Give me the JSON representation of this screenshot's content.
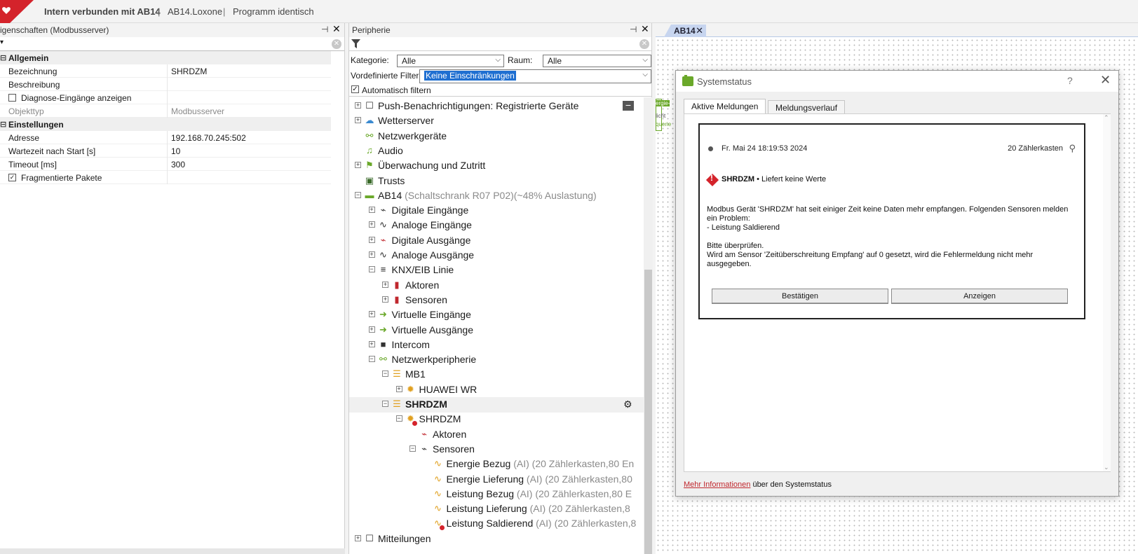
{
  "titlebar": {
    "main": "Intern verbunden mit AB14",
    "sep": "|",
    "file": "AB14.Loxone",
    "status": "Programm identisch"
  },
  "props": {
    "title": "igenschaften (Modbusserver)",
    "pin": "⊣",
    "close": "✕",
    "rows": [
      {
        "k": "Allgemein",
        "v": "",
        "cat": true
      },
      {
        "k": "Bezeichnung",
        "v": "SHRDZM"
      },
      {
        "k": "Beschreibung",
        "v": ""
      },
      {
        "k": "Diagnose-Eingänge anzeigen",
        "v": "",
        "checkbox": false
      },
      {
        "k": "Objekttyp",
        "v": "Modbusserver",
        "muted": true
      },
      {
        "k": "Einstellungen",
        "v": "",
        "cat": true
      },
      {
        "k": "Adresse",
        "v": "192.168.70.245:502"
      },
      {
        "k": "Wartezeit nach Start [s]",
        "v": "10"
      },
      {
        "k": "Timeout [ms]",
        "v": "300"
      },
      {
        "k": "Fragmentierte Pakete",
        "v": "",
        "checkbox": true
      }
    ]
  },
  "periph": {
    "title": "Peripherie",
    "kategorie_label": "Kategorie:",
    "kategorie_value": "Alle",
    "raum_label": "Raum:",
    "raum_value": "Alle",
    "filter_label": "Vordefinierte Filter",
    "filter_value": "Keine Einschränkungen",
    "autofilter_label": "Automatisch filtern",
    "tree": [
      {
        "t": "Push-Benachrichtigungen: Registrierte Geräte",
        "x": "",
        "icon": "☐",
        "ic": "#333"
      },
      {
        "t": "Wetterserver",
        "x": "",
        "icon": "☁",
        "ic": "#3a8ad0"
      },
      {
        "t": "Netzwerkgeräte",
        "x": "",
        "icon": "⚯",
        "ic": "#6aa82a"
      },
      {
        "t": "Audio",
        "x": "",
        "icon": "♫",
        "ic": "#6aa82a"
      },
      {
        "t": "Überwachung und Zutritt",
        "x": "",
        "icon": "⚑",
        "ic": "#6aa82a"
      },
      {
        "t": "Trusts",
        "x": "",
        "icon": "▣",
        "ic": "#3a6a2a"
      },
      {
        "t": "AB14",
        "x": "(Schaltschrank R07 P02)(~48% Auslastung)",
        "icon": "▬",
        "ic": "#6aa82a"
      },
      {
        "t": "Digitale Eingänge",
        "x": "",
        "icon": "⌁",
        "ic": "#333"
      },
      {
        "t": "Analoge Eingänge",
        "x": "",
        "icon": "∿",
        "ic": "#333"
      },
      {
        "t": "Digitale Ausgänge",
        "x": "",
        "icon": "⌁",
        "ic": "#c0272d"
      },
      {
        "t": "Analoge Ausgänge",
        "x": "",
        "icon": "∿",
        "ic": "#333"
      },
      {
        "t": "KNX/EIB Linie",
        "x": "",
        "icon": "≡",
        "ic": "#222"
      },
      {
        "t": "Aktoren",
        "x": "",
        "icon": "▮",
        "ic": "#c0272d"
      },
      {
        "t": "Sensoren",
        "x": "",
        "icon": "▮",
        "ic": "#c0272d"
      },
      {
        "t": "Virtuelle Eingänge",
        "x": "",
        "icon": "➜",
        "ic": "#6aa82a"
      },
      {
        "t": "Virtuelle Ausgänge",
        "x": "",
        "icon": "➜",
        "ic": "#6aa82a"
      },
      {
        "t": "Intercom",
        "x": "",
        "icon": "■",
        "ic": "#333"
      },
      {
        "t": "Netzwerkperipherie",
        "x": "",
        "icon": "⚯",
        "ic": "#6aa82a"
      },
      {
        "t": "MB1",
        "x": "",
        "icon": "☰",
        "ic": "#e0a020"
      },
      {
        "t": "HUAWEI WR",
        "x": "",
        "icon": "✹",
        "ic": "#e0a020"
      },
      {
        "t": "SHRDZM",
        "x": "",
        "icon": "☰",
        "ic": "#e0a020"
      },
      {
        "t": "SHRDZM",
        "x": "",
        "icon": "✹",
        "ic": "#e0a020"
      },
      {
        "t": "Aktoren",
        "x": "",
        "icon": "⌁",
        "ic": "#c0272d"
      },
      {
        "t": "Sensoren",
        "x": "",
        "icon": "⌁",
        "ic": "#333"
      },
      {
        "t": "Energie Bezug",
        "x": "(AI) (20 Zählerkasten,80 En",
        "icon": "∿",
        "ic": "#e0a020"
      },
      {
        "t": "Energie Lieferung",
        "x": "(AI) (20 Zählerkasten,80",
        "icon": "∿",
        "ic": "#e0a020"
      },
      {
        "t": "Leistung Bezug",
        "x": "(AI) (20 Zählerkasten,80 E",
        "icon": "∿",
        "ic": "#e0a020"
      },
      {
        "t": "Leistung Lieferung",
        "x": "(AI) (20 Zählerkasten,8",
        "icon": "∿",
        "ic": "#e0a020"
      },
      {
        "t": "Leistung Saldierend",
        "x": "(AI) (20 Zählerkasten,8",
        "icon": "∿",
        "ic": "#e0a020"
      },
      {
        "t": "Mitteilungen",
        "x": "",
        "icon": "☐",
        "ic": "#333"
      }
    ]
  },
  "canvas": {
    "tab": "AB14",
    "tab_close": "✕",
    "snip1": "ergie-",
    "snip2": "licht",
    "snip3": "querie"
  },
  "dialog": {
    "title": "Systemstatus",
    "help": "?",
    "close": "✕",
    "tab_active": "Aktive Meldungen",
    "tab_history": "Meldungsverlauf",
    "msg_date": "Fr. Mai 24 18:19:53 2024",
    "msg_location": "20 Zählerkasten",
    "msg_device": "SHRDZM",
    "msg_title_rest": " • Liefert keine Werte",
    "msg_line1": "Modbus Gerät 'SHRDZM' hat seit einiger Zeit keine Daten mehr empfangen. Folgenden Sensoren melden ein Problem:",
    "msg_line2": "- Leistung Saldierend",
    "msg_line3": "Bitte überprüfen.",
    "msg_line4": "Wird am Sensor 'Zeitüberschreitung Empfang' auf 0 gesetzt, wird die Fehlermeldung nicht mehr ausgegeben.",
    "btn_confirm": "Bestätigen",
    "btn_show": "Anzeigen",
    "footer_link": "Mehr Informationen",
    "footer_rest": " über den Systemstatus"
  },
  "colors": {
    "accent": "#d4232b",
    "tree_selected": "#f0f0f0",
    "link": "#c0272d"
  }
}
